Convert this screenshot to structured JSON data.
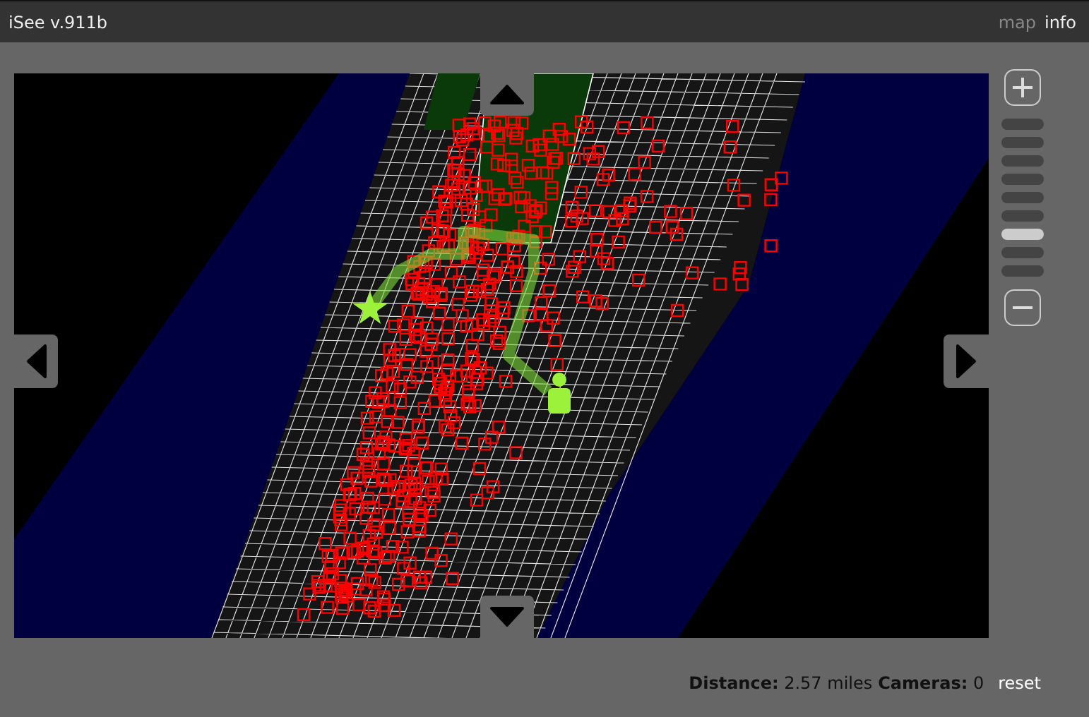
{
  "window": {
    "title": "iSee v.911b"
  },
  "tabs": [
    {
      "label": "map",
      "selected": true
    },
    {
      "label": "info",
      "selected": false
    }
  ],
  "zoom": {
    "levels": [
      {
        "selected": false
      },
      {
        "selected": false
      },
      {
        "selected": false
      },
      {
        "selected": false
      },
      {
        "selected": false
      },
      {
        "selected": false
      },
      {
        "selected": true
      },
      {
        "selected": false
      },
      {
        "selected": false
      }
    ]
  },
  "status_bar": {
    "stats": [
      {
        "label": "Distance:",
        "value": "2.57 miles"
      },
      {
        "label": "Cameras:",
        "value": "0"
      }
    ],
    "reset": "reset"
  }
}
